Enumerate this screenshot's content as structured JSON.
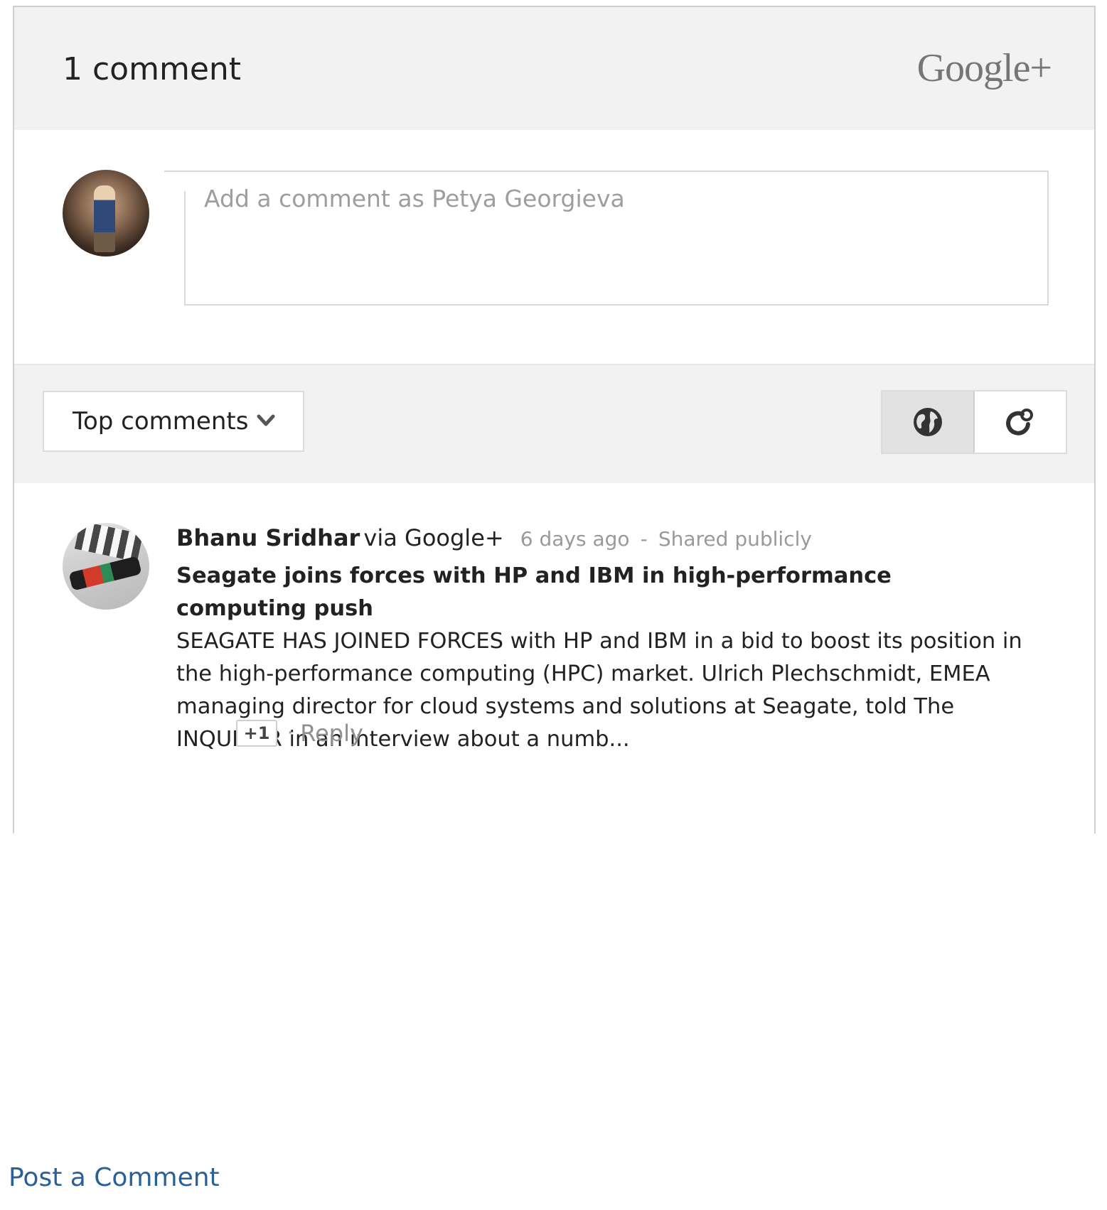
{
  "header": {
    "count_label": "1 comment",
    "brand": "Google+"
  },
  "compose": {
    "placeholder": "Add a comment as Petya Georgieva",
    "avatar_icon": "user-avatar"
  },
  "toolbar": {
    "sort_label": "Top comments",
    "sort_icon": "chevron-down-icon",
    "view_buttons": [
      {
        "icon": "globe-icon",
        "active": true
      },
      {
        "icon": "circles-icon",
        "active": false
      }
    ]
  },
  "comments": [
    {
      "author": "Bhanu Sridhar",
      "via": "via Google+",
      "time": "6 days ago",
      "separator": "-",
      "visibility": "Shared publicly",
      "title": "Seagate joins forces with HP and IBM in high-performance computing push",
      "text": "SEAGATE HAS JOINED FORCES with HP and IBM in a bid to boost its position in the high-performance computing (HPC) market. Ulrich Plechschmidt, EMEA managing director for cloud systems and solutions at Seagate, told  The INQUIRER  in an interview about a numb...",
      "plus_one": "+1",
      "action_separator": "·",
      "reply": "Reply"
    }
  ],
  "footer": {
    "post_link": "Post a Comment"
  },
  "colors": {
    "header_bg": "#f2f2f2",
    "link": "#2a6099",
    "muted": "#9a9a9a"
  }
}
